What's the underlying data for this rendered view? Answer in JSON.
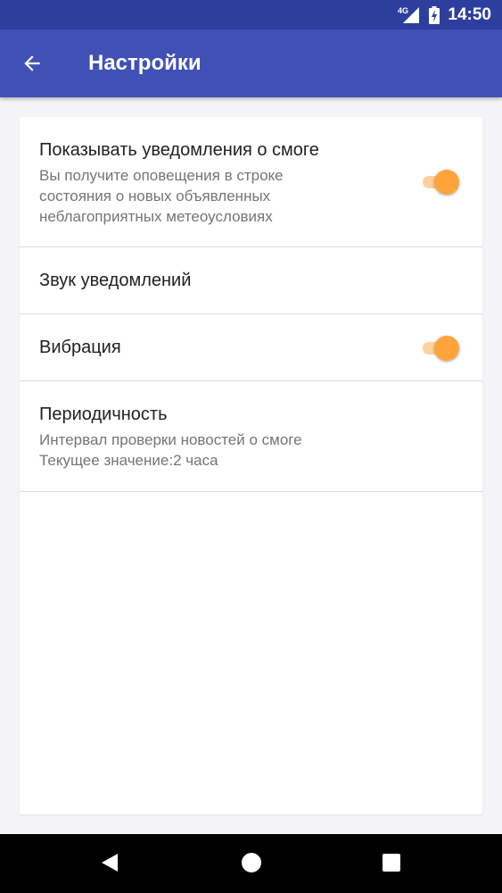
{
  "status_bar": {
    "network": "4G",
    "time": "14:50",
    "icons": [
      "signal-icon",
      "battery-charging-icon"
    ]
  },
  "app_bar": {
    "title": "Настройки",
    "back_icon": "arrow-back-icon",
    "color": "#3f51b5"
  },
  "settings": {
    "smog_notifications": {
      "title": "Показывать уведомления о смоге",
      "summary": [
        "Вы получите оповещения в строке",
        "состояния о новых объявленных",
        "неблагоприятных метеоусловиях"
      ],
      "enabled": true
    },
    "notification_sound": {
      "title": "Звук уведомлений"
    },
    "vibration": {
      "title": "Вибрация",
      "enabled": true
    },
    "periodicity": {
      "title": "Периодичность",
      "summary": [
        "Интервал проверки новостей о смоге",
        "Текущее значение:2 часа"
      ]
    }
  },
  "accent_color": "#ffa43b",
  "navigation_bar": {
    "icons": [
      "back-triangle-icon",
      "home-circle-icon",
      "recents-square-icon"
    ]
  }
}
